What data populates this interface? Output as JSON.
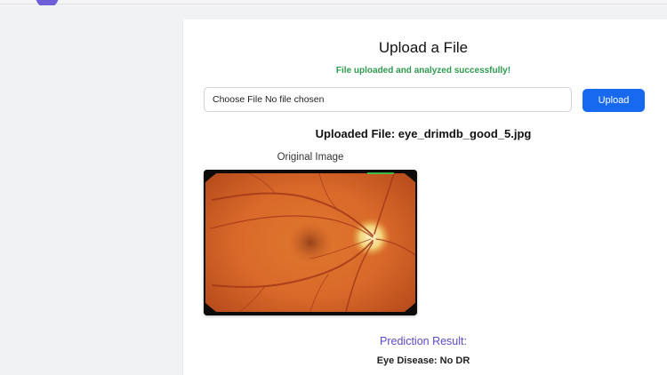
{
  "upload": {
    "title": "Upload a File",
    "success_message": "File uploaded and analyzed successfully!",
    "file_input_text": "Choose File No file chosen",
    "upload_button_label": "Upload",
    "uploaded_file_label": "Uploaded File: eye_drimdb_good_5.jpg"
  },
  "image": {
    "label": "Original Image"
  },
  "prediction": {
    "title": "Prediction Result:",
    "result": "Eye Disease: No DR"
  },
  "colors": {
    "accent": "#1769f0",
    "success": "#2e9a4e",
    "prediction_title": "#5a4bc6",
    "avatar": "#6d5fd8"
  }
}
